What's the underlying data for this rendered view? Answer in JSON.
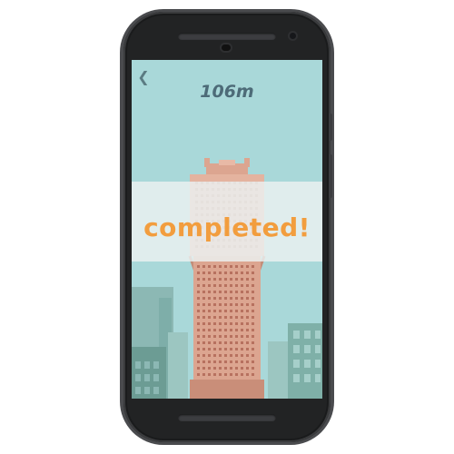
{
  "screen": {
    "height_readout": "106m",
    "status_message": "completed!",
    "back_icon": "chevron-left-icon"
  },
  "colors": {
    "sky": "#a9d8d9",
    "accent": "#f29d3e",
    "tower": "#dca590",
    "text": "#4d6b78"
  }
}
